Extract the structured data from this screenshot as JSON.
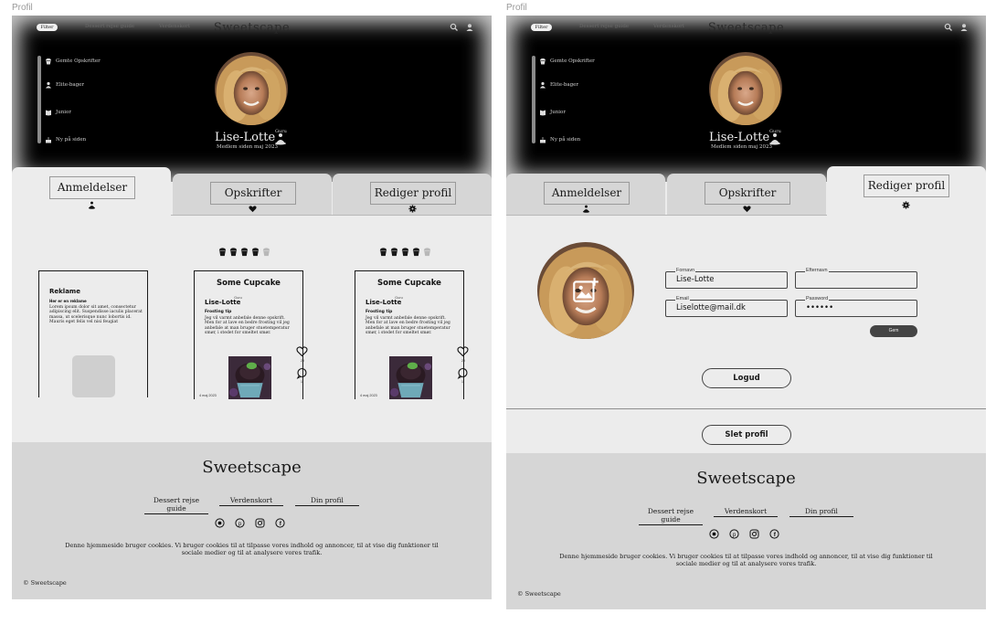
{
  "frames": [
    {
      "label": "Profil",
      "nav": {
        "filter": "Filter",
        "links": [
          "Dessert rejse guide",
          "Verdenskort"
        ],
        "brand": "Sweetscape"
      },
      "sidebar": [
        "Gemte Opskrifter",
        "Elite-bager",
        "Junior",
        "Ny på siden"
      ],
      "profile": {
        "name": "Lise-Lotte",
        "rank": "Guru",
        "member_since": "Medlem siden maj 2023"
      },
      "tabs": [
        "Anmeldelser",
        "Opskrifter",
        "Rediger profil"
      ],
      "ad": {
        "title": "Reklame",
        "subtitle": "Her er en reklame",
        "text": "Lorem ipsum dolor sit amet, consectetur adipiscing elit. Suspendisse iaculis placerat massa, ut scelerisque nunc lobortis id. Mauris eget felis vel nisi feugiat"
      },
      "cards": [
        {
          "title": "Some Cupcake",
          "author": "Lise-Lotte",
          "rank": "Guru",
          "subtitle": "Frosting tip",
          "text": "Jeg vil varmt anbefale denne opskrift. Men for at lave en bedre frosting vil jeg anbefale at man bruger stuetemperatur smør, i stedet for smeltet smør.",
          "date": "4 maj 2023",
          "likes": "29",
          "comments": "1",
          "rating": 4
        },
        {
          "title": "Some Cupcake",
          "author": "Lise-Lotte",
          "rank": "Guru",
          "subtitle": "Frosting tip",
          "text": "Jeg vil varmt anbefale denne opskrift. Men for at lave en bedre frosting vil jeg anbefale at man bruger stuetemperatur smør, i stedet for smeltet smør.",
          "date": "4 maj 2023",
          "likes": "29",
          "comments": "1",
          "rating": 4
        }
      ],
      "footer": {
        "brand": "Sweetscape",
        "links": [
          "Dessert rejse guide",
          "Verdenskort",
          "Din profil"
        ],
        "social_icons": [
          "pinterest-icon",
          "pinterest-icon",
          "instagram-icon",
          "facebook-icon"
        ],
        "cookie": "Denne hjemmeside bruger cookies. Vi bruger cookies til at tilpasse vores indhold og annoncer, til at vise dig funktioner til sociale medier og til at analysere vores trafik.",
        "copyright": "© Sweetscape"
      }
    },
    {
      "label": "Profil",
      "nav": {
        "filter": "Filter",
        "links": [
          "Dessert rejse guide",
          "Verdenskort"
        ],
        "brand": "Sweetscape"
      },
      "sidebar": [
        "Gemte Opskrifter",
        "Elite-bager",
        "Junior",
        "Ny på siden"
      ],
      "profile": {
        "name": "Lise-Lotte",
        "rank": "Guru",
        "member_since": "Medlem siden maj 2023"
      },
      "tabs": [
        "Anmeldelser",
        "Opskrifter",
        "Rediger profil"
      ],
      "form": {
        "firstname": {
          "label": "Fornavn",
          "value": "Lise-Lotte"
        },
        "lastname": {
          "label": "Efternavn",
          "value": ""
        },
        "email": {
          "label": "Email",
          "value": "Liselotte@mail.dk"
        },
        "password": {
          "label": "Password",
          "value": "••••••"
        },
        "save": "Gem",
        "logout": "Logud",
        "delete": "Slet profil"
      },
      "footer": {
        "brand": "Sweetscape",
        "links": [
          "Dessert rejse guide",
          "Verdenskort",
          "Din profil"
        ],
        "social_icons": [
          "pinterest-icon",
          "pinterest-icon",
          "instagram-icon",
          "facebook-icon"
        ],
        "cookie": "Denne hjemmeside bruger cookies. Vi bruger cookies til at tilpasse vores indhold og annoncer, til at vise dig funktioner til sociale medier og til at analysere vores trafik.",
        "copyright": "© Sweetscape"
      }
    }
  ],
  "colors": {
    "hero": "#000000",
    "page": "#ececec",
    "tab_inactive": "#d6d6d6",
    "footer": "#d6d6d6",
    "button_dark": "#444444"
  }
}
